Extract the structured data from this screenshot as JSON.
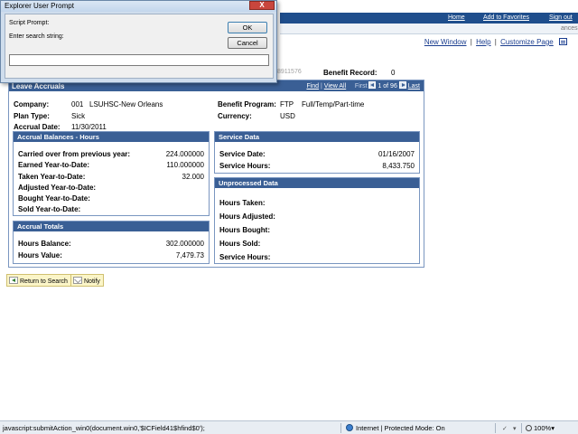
{
  "nav": {
    "home": "Home",
    "add_to_favorites": "Add to Favorites",
    "sign_out": "Sign out",
    "obscured_text": "ances"
  },
  "page_links": {
    "new_window": "New Window",
    "help": "Help",
    "customize_page": "Customize Page",
    "sep": "|"
  },
  "header": {
    "blurred_id": "8911576",
    "benefit_record_label": "Benefit Record:",
    "benefit_record_value": "0"
  },
  "panel": {
    "title": "Leave Accruals",
    "find": "Find",
    "view_all": "View All",
    "first": "First",
    "position": "1 of 96",
    "last": "Last",
    "company_label": "Company:",
    "company_code": "001",
    "company_name": "LSUHSC-New Orleans",
    "plan_type_label": "Plan Type:",
    "plan_type_value": "Sick",
    "accrual_date_label": "Accrual Date:",
    "accrual_date_value": "11/30/2011",
    "benefit_program_label": "Benefit Program:",
    "benefit_program_code": "FTP",
    "benefit_program_name": "Full/Temp/Part-time",
    "currency_label": "Currency:",
    "currency_value": "USD"
  },
  "accrual_balances": {
    "title": "Accrual Balances - Hours",
    "rows": [
      {
        "label": "Carried over from previous year:",
        "value": "224.000000"
      },
      {
        "label": "Earned Year-to-Date:",
        "value": "110.000000"
      },
      {
        "label": "Taken Year-to-Date:",
        "value": "32.000"
      },
      {
        "label": "Adjusted Year-to-Date:",
        "value": ""
      },
      {
        "label": "Bought Year-to-Date:",
        "value": ""
      },
      {
        "label": "Sold Year-to-Date:",
        "value": ""
      }
    ]
  },
  "accrual_totals": {
    "title": "Accrual Totals",
    "rows": [
      {
        "label": "Hours Balance:",
        "value": "302.000000"
      },
      {
        "label": "Hours Value:",
        "value": "7,479.73"
      }
    ]
  },
  "service_data": {
    "title": "Service Data",
    "rows": [
      {
        "label": "Service Date:",
        "value": "01/16/2007"
      },
      {
        "label": "Service Hours:",
        "value": "8,433.750"
      }
    ]
  },
  "unprocessed_data": {
    "title": "Unprocessed Data",
    "rows": [
      {
        "label": "Hours Taken:"
      },
      {
        "label": "Hours Adjusted:"
      },
      {
        "label": "Hours Bought:"
      },
      {
        "label": "Hours Sold:"
      },
      {
        "label": "Service Hours:"
      }
    ]
  },
  "buttons": {
    "return_to_search": "Return to Search",
    "notify": "Notify"
  },
  "dialog": {
    "title": "Explorer User Prompt",
    "script_prompt": "Script Prompt:",
    "enter_search": "Enter search string:",
    "ok": "OK",
    "cancel": "Cancel",
    "close": "X",
    "input_value": ""
  },
  "statusbar": {
    "url": "javascript:submitAction_win0(document.win0,'$ICField41$hfind$0');",
    "zone": "Internet | Protected Mode: On",
    "zoom": "100%",
    "zoom_arrow": "▾"
  },
  "colors": {
    "panel_header": "#3a5f95",
    "nav_bar": "#1f4e8c",
    "link": "#1a3d8f"
  }
}
